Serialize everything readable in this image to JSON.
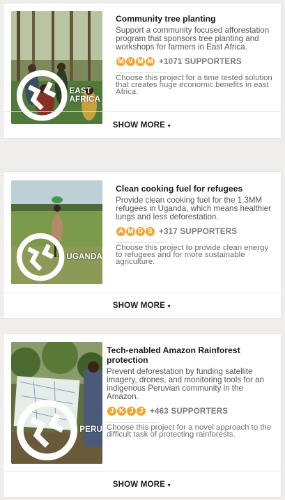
{
  "projects": [
    {
      "title": "Community tree planting",
      "description": "Support a community focused afforestation program that sponsors tree planting and workshops for farmers in East Africa.",
      "location": "EAST AFRICA",
      "avatars": [
        "M",
        "V",
        "M",
        "M"
      ],
      "supporters": "+1071 SUPPORTERS",
      "reason": "Choose this project for a time tested solution that creates huge economic benefits in east Africa.",
      "show_more": "SHOW MORE"
    },
    {
      "title": "Clean cooking fuel for refugees",
      "description": "Provide clean cooking fuel for the 1.3MM refugees in Uganda, which means healthier lungs and less deforestation.",
      "location": "UGANDA",
      "avatars": [
        "A",
        "M",
        "D",
        "S"
      ],
      "supporters": "+317 SUPPORTERS",
      "reason": "Choose this project to provide clean energy to refugees and for more sustainable agriculture.",
      "show_more": "SHOW MORE"
    },
    {
      "title": "Tech-enabled Amazon Rainforest protection",
      "description": "Prevent deforestation by funding satellite imagery, drones, and monitoring tools for an indigenous Peruvian community in the Amazon.",
      "location": "PERU",
      "avatars": [
        "J",
        "K",
        "J",
        "J"
      ],
      "supporters": "+463 SUPPORTERS",
      "reason": "Choose this project for a novel approach to the difficult task of protecting rainforests.",
      "show_more": "SHOW MORE"
    }
  ],
  "colors": {
    "avatar": "#f0a531",
    "background": "#efeeec"
  },
  "icons": {
    "location": "globe-icon",
    "expand": "chevron-down-icon"
  }
}
